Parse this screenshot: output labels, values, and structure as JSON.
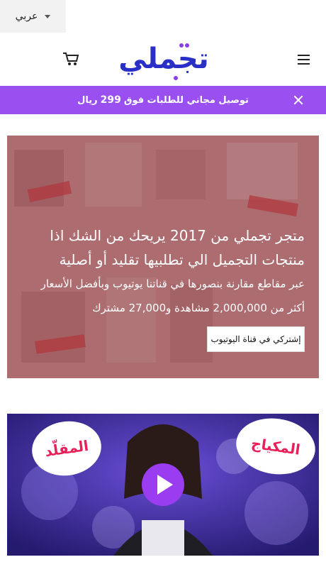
{
  "lang_selector": {
    "label": "عربي"
  },
  "header": {
    "logo_text": "تجملي"
  },
  "banner": {
    "text_before": "توصيل مجاني للطلبات فوق",
    "amount": "299",
    "currency": "ريال"
  },
  "hero": {
    "headline": "متجر تجملي من 2017 يريحك من الشك اذا منتجات التجميل الي تطلبيها تقليد أو أصلية",
    "subline": "عبر مقاطع مقارنة بنصورها في قناتنا يوتيوب وبأفضل الأسعار",
    "stats": "أكثر من 2,000,000 مشاهدة و27,000 مشترك",
    "button_label": "إشتركي في قناة اليوتيوب"
  },
  "video": {
    "bubble_left": "المقلّد",
    "bubble_right": "المكياج"
  },
  "colors": {
    "accent": "#9a4ff0",
    "logo_blue": "#2a2fc7",
    "logo_purple": "#8b3df0"
  }
}
